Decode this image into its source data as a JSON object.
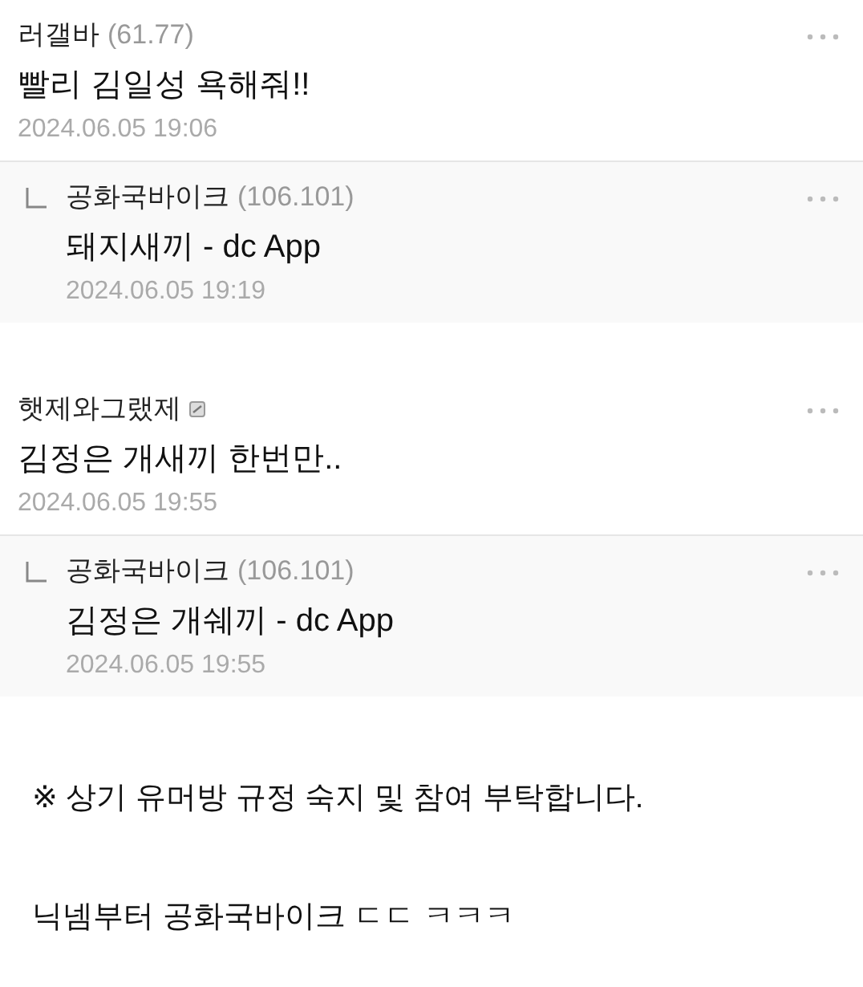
{
  "comments": [
    {
      "nickname": "러갤바",
      "ip": "(61.77)",
      "fixed_nick": false,
      "text": "빨리 김일성 욕해줘!!",
      "date": "2024.06.05 19:06",
      "children": [
        {
          "nickname": "공화국바이크",
          "ip": "(106.101)",
          "fixed_nick": false,
          "text": "돼지새끼 - dc App",
          "date": "2024.06.05 19:19"
        }
      ]
    },
    {
      "nickname": "햇제와그랬제",
      "fixed_nick": true,
      "text": "김정은 개새끼 한번만..",
      "date": "2024.06.05 19:55",
      "children": [
        {
          "nickname": "공화국바이크",
          "ip": "(106.101)",
          "fixed_nick": false,
          "text": "김정은 개쉐끼 - dc App",
          "date": "2024.06.05 19:55"
        }
      ]
    }
  ],
  "notes": [
    "※ 상기 유머방 규정 숙지 및 참여 부탁합니다.",
    "닉넴부터 공화국바이크 ㄷㄷ ㅋㅋㅋ"
  ]
}
